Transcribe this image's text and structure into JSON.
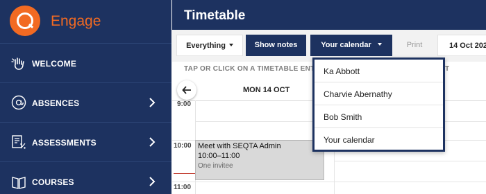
{
  "app": {
    "brand": "Engage",
    "brand_color": "#f26a22",
    "nav_color": "#1d3260"
  },
  "sidebar": {
    "items": [
      {
        "label": "WELCOME",
        "icon": "hand-wave-icon",
        "has_chevron": false
      },
      {
        "label": "ABSENCES",
        "icon": "at-sign-icon",
        "has_chevron": true
      },
      {
        "label": "ASSESSMENTS",
        "icon": "assessment-percent-icon",
        "has_chevron": true
      },
      {
        "label": "COURSES",
        "icon": "book-icon",
        "has_chevron": true
      }
    ]
  },
  "header": {
    "title": "Timetable"
  },
  "toolbar": {
    "filter_label": "Everything",
    "notes_label": "Show notes",
    "calendar_label": "Your calendar",
    "print_label": "Print",
    "date_label": "14 Oct 202"
  },
  "calendar": {
    "hint": "TAP OR CLICK ON A TIMETABLE ENTRY",
    "hint_tail": "T",
    "day": "MON 14 OCT",
    "times": [
      "9:00",
      "10:00",
      "11:00"
    ]
  },
  "event": {
    "title": "Meet with SEQTA Admin",
    "time": "10:00–11:00",
    "subtitle": "One invitee"
  },
  "dropdown": {
    "options": [
      "Ka Abbott",
      "Charvie Abernathy",
      "Bob Smith",
      "Your calendar"
    ]
  }
}
